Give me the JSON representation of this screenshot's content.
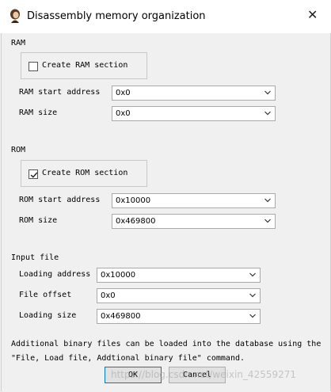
{
  "window": {
    "title": "Disassembly memory organization",
    "close_glyph": "✕"
  },
  "ram": {
    "heading": "RAM",
    "create_label": "Create RAM section",
    "create_checked": false,
    "start_label": "RAM start address",
    "start_value": "0x0",
    "size_label": "RAM size",
    "size_value": "0x0"
  },
  "rom": {
    "heading": "ROM",
    "create_label": "Create ROM section",
    "create_checked": true,
    "start_label": "ROM start address",
    "start_value": "0x10000",
    "size_label": "ROM size",
    "size_value": "0x469800"
  },
  "input_file": {
    "heading": "Input file",
    "loading_address_label": "Loading address",
    "loading_address_value": "0x10000",
    "file_offset_label": "File offset",
    "file_offset_value": "0x0",
    "loading_size_label": "Loading size",
    "loading_size_value": "0x469800"
  },
  "message": {
    "line1": "Additional binary files can be loaded into the database using the",
    "line2": "\"File, Load file, Addtional binary file\" command."
  },
  "buttons": {
    "ok": "OK",
    "cancel": "Cancel"
  },
  "watermark": "https://blog.csdn.net/weixin_42559271"
}
